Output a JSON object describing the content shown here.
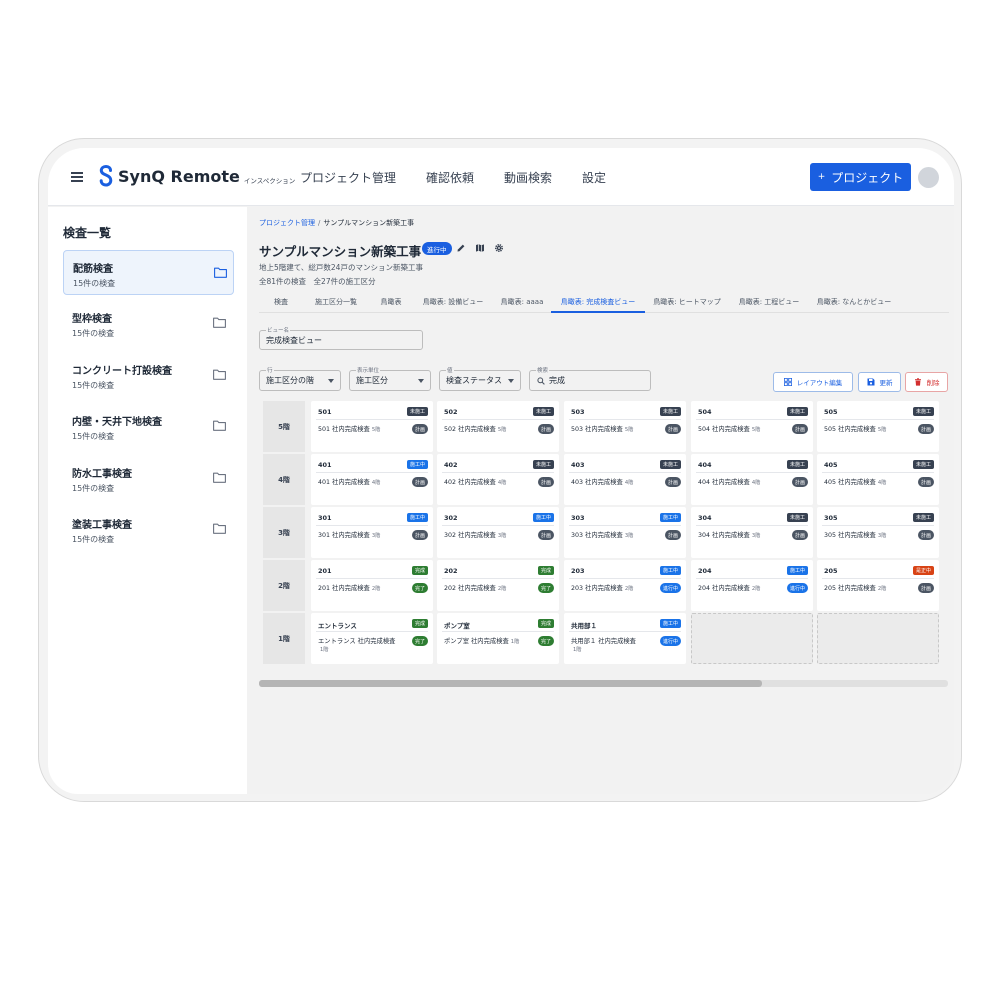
{
  "header": {
    "logo_text": "SynQ Remote",
    "logo_sub": "インスペクション",
    "nav": [
      "プロジェクト管理",
      "確認依頼",
      "動画検索",
      "設定"
    ],
    "new_project_label": "プロジェクト",
    "new_project_icon": "plus-icon",
    "brand_color": "#1a5fe0"
  },
  "sidebar": {
    "title": "検査一覧",
    "items": [
      {
        "name": "配筋検査",
        "count": "15件の検査",
        "active": true
      },
      {
        "name": "型枠検査",
        "count": "15件の検査"
      },
      {
        "name": "コンクリート打設検査",
        "count": "15件の検査"
      },
      {
        "name": "内壁・天井下地検査",
        "count": "15件の検査"
      },
      {
        "name": "防水工事検査",
        "count": "15件の検査"
      },
      {
        "name": "塗装工事検査",
        "count": "15件の検査"
      }
    ]
  },
  "breadcrumb": {
    "link": "プロジェクト管理",
    "separator": "/",
    "current": "サンプルマンション新築工事"
  },
  "project": {
    "title": "サンプルマンション新築工事",
    "status": "進行中",
    "description": "地上5階建て、総戸数24戸のマンション新築工事",
    "stats": "全81件の検査　全27件の施工区分",
    "icons": [
      "edit-icon",
      "map-icon",
      "settings-icon"
    ]
  },
  "tabs": [
    "検査",
    "施工区分一覧",
    "鳥瞰表",
    "鳥瞰表: 設備ビュー",
    "鳥瞰表: aaaa",
    "鳥瞰表: 完成検査ビュー",
    "鳥瞰表: ヒートマップ",
    "鳥瞰表: 工程ビュー",
    "鳥瞰表: なんとかビュー"
  ],
  "active_tab": 5,
  "view_name": {
    "label": "ビュー名",
    "value": "完成検査ビュー"
  },
  "filters": {
    "row": {
      "label": "行",
      "value": "施工区分の階"
    },
    "unit": {
      "label": "表示単位",
      "value": "施工区分"
    },
    "value": {
      "label": "値",
      "value": "検査ステータス"
    },
    "search": {
      "label": "検索",
      "value": "完成"
    }
  },
  "actions": {
    "layout_edit": "レイアウト編集",
    "update": "更新",
    "delete": "削除"
  },
  "status_colors": {
    "未施工": "#374151",
    "施工中": "#1a73e8",
    "完成": "#2e7d32",
    "是正中": "#d84315",
    "計画": "#4b5563",
    "進行中": "#1a73e8",
    "完了": "#2e7d32"
  },
  "floors": [
    {
      "label": "5階",
      "cells": [
        {
          "name": "501",
          "status": "未施工",
          "inspection": "501 社内完成検査",
          "floor": "5階",
          "badge": "計画"
        },
        {
          "name": "502",
          "status": "未施工",
          "inspection": "502 社内完成検査",
          "floor": "5階",
          "badge": "計画"
        },
        {
          "name": "503",
          "status": "未施工",
          "inspection": "503 社内完成検査",
          "floor": "5階",
          "badge": "計画"
        },
        {
          "name": "504",
          "status": "未施工",
          "inspection": "504 社内完成検査",
          "floor": "5階",
          "badge": "計画"
        },
        {
          "name": "505",
          "status": "未施工",
          "inspection": "505 社内完成検査",
          "floor": "5階",
          "badge": "計画"
        }
      ]
    },
    {
      "label": "4階",
      "cells": [
        {
          "name": "401",
          "status": "施工中",
          "inspection": "401 社内完成検査",
          "floor": "4階",
          "badge": "計画"
        },
        {
          "name": "402",
          "status": "未施工",
          "inspection": "402 社内完成検査",
          "floor": "4階",
          "badge": "計画"
        },
        {
          "name": "403",
          "status": "未施工",
          "inspection": "403 社内完成検査",
          "floor": "4階",
          "badge": "計画"
        },
        {
          "name": "404",
          "status": "未施工",
          "inspection": "404 社内完成検査",
          "floor": "4階",
          "badge": "計画"
        },
        {
          "name": "405",
          "status": "未施工",
          "inspection": "405 社内完成検査",
          "floor": "4階",
          "badge": "計画"
        }
      ]
    },
    {
      "label": "3階",
      "cells": [
        {
          "name": "301",
          "status": "施工中",
          "inspection": "301 社内完成検査",
          "floor": "3階",
          "badge": "計画"
        },
        {
          "name": "302",
          "status": "施工中",
          "inspection": "302 社内完成検査",
          "floor": "3階",
          "badge": "計画"
        },
        {
          "name": "303",
          "status": "施工中",
          "inspection": "303 社内完成検査",
          "floor": "3階",
          "badge": "計画"
        },
        {
          "name": "304",
          "status": "未施工",
          "inspection": "304 社内完成検査",
          "floor": "3階",
          "badge": "計画"
        },
        {
          "name": "305",
          "status": "未施工",
          "inspection": "305 社内完成検査",
          "floor": "3階",
          "badge": "計画"
        }
      ]
    },
    {
      "label": "2階",
      "cells": [
        {
          "name": "201",
          "status": "完成",
          "inspection": "201 社内完成検査",
          "floor": "2階",
          "badge": "完了"
        },
        {
          "name": "202",
          "status": "完成",
          "inspection": "202 社内完成検査",
          "floor": "2階",
          "badge": "完了"
        },
        {
          "name": "203",
          "status": "施工中",
          "inspection": "203 社内完成検査",
          "floor": "2階",
          "badge": "進行中"
        },
        {
          "name": "204",
          "status": "施工中",
          "inspection": "204 社内完成検査",
          "floor": "2階",
          "badge": "進行中"
        },
        {
          "name": "205",
          "status": "是正中",
          "inspection": "205 社内完成検査",
          "floor": "2階",
          "badge": "計画"
        }
      ]
    },
    {
      "label": "1階",
      "cells": [
        {
          "name": "エントランス",
          "status": "完成",
          "inspection": "エントランス 社内完成検査",
          "floor": "1階",
          "badge": "完了",
          "wrap": true
        },
        {
          "name": "ポンプ室",
          "status": "完成",
          "inspection": "ポンプ室 社内完成検査",
          "floor": "1階",
          "badge": "完了"
        },
        {
          "name": "共用部１",
          "status": "施工中",
          "inspection": "共用部１ 社内完成検査",
          "floor": "1階",
          "badge": "進行中",
          "wrap": true
        },
        {
          "empty": true
        },
        {
          "empty": true
        }
      ]
    }
  ],
  "scroll_fraction": 0.73
}
